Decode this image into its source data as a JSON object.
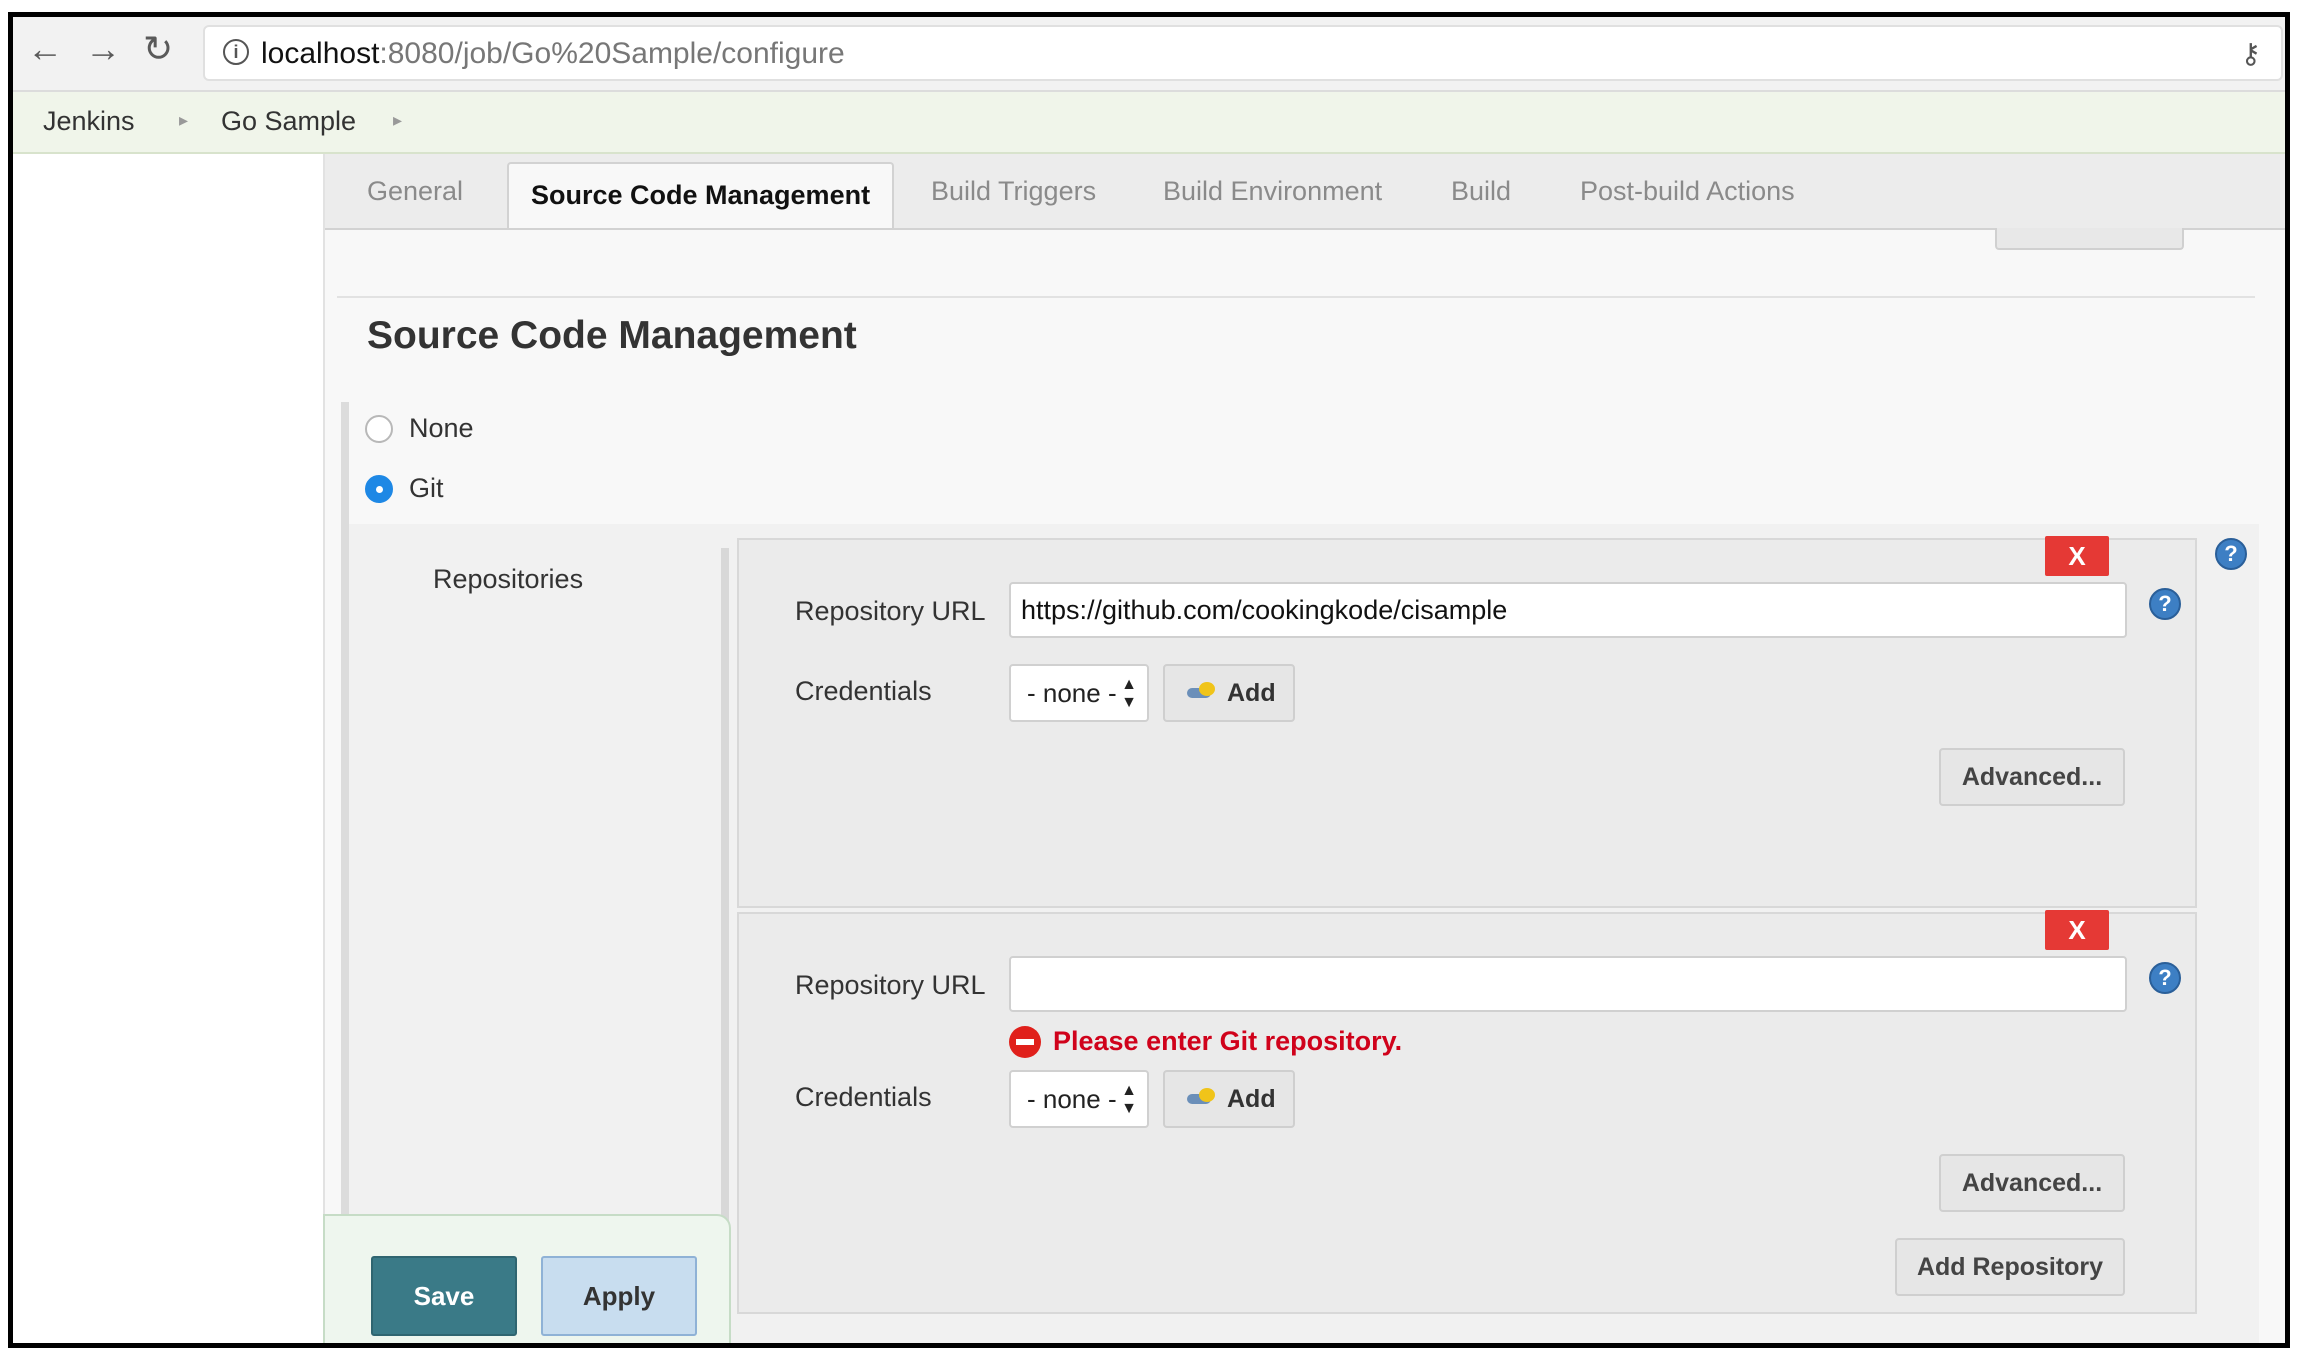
{
  "browser": {
    "url_host": "localhost",
    "url_path": ":8080/job/Go%20Sample/configure",
    "info_icon": "i"
  },
  "breadcrumb": {
    "items": [
      "Jenkins",
      "Go Sample"
    ],
    "separator": "▸"
  },
  "tabs": [
    {
      "label": "General",
      "active": false
    },
    {
      "label": "Source Code Management",
      "active": true
    },
    {
      "label": "Build Triggers",
      "active": false
    },
    {
      "label": "Build Environment",
      "active": false
    },
    {
      "label": "Build",
      "active": false
    },
    {
      "label": "Post-build Actions",
      "active": false
    }
  ],
  "section": {
    "title": "Source Code Management",
    "options": [
      {
        "label": "None",
        "checked": false
      },
      {
        "label": "Git",
        "checked": true
      }
    ]
  },
  "repositories": {
    "label": "Repositories",
    "blocks": [
      {
        "delete_label": "X",
        "url_label": "Repository URL",
        "url_value": "https://github.com/cookingkode/cisample",
        "credentials_label": "Credentials",
        "credentials_value": "- none -",
        "add_label": "Add",
        "advanced_label": "Advanced..."
      },
      {
        "delete_label": "X",
        "url_label": "Repository URL",
        "url_value": "",
        "error": "Please enter Git repository.",
        "credentials_label": "Credentials",
        "credentials_value": "- none -",
        "add_label": "Add",
        "advanced_label": "Advanced...",
        "add_repository_label": "Add Repository"
      }
    ]
  },
  "actions": {
    "save_label": "Save",
    "apply_label": "Apply"
  },
  "help_glyph": "?",
  "colors": {
    "delete": "#e53935",
    "error": "#d0021b",
    "save": "#3a7a87",
    "apply": "#c8ddef",
    "radio_selected": "#1e88e5"
  }
}
